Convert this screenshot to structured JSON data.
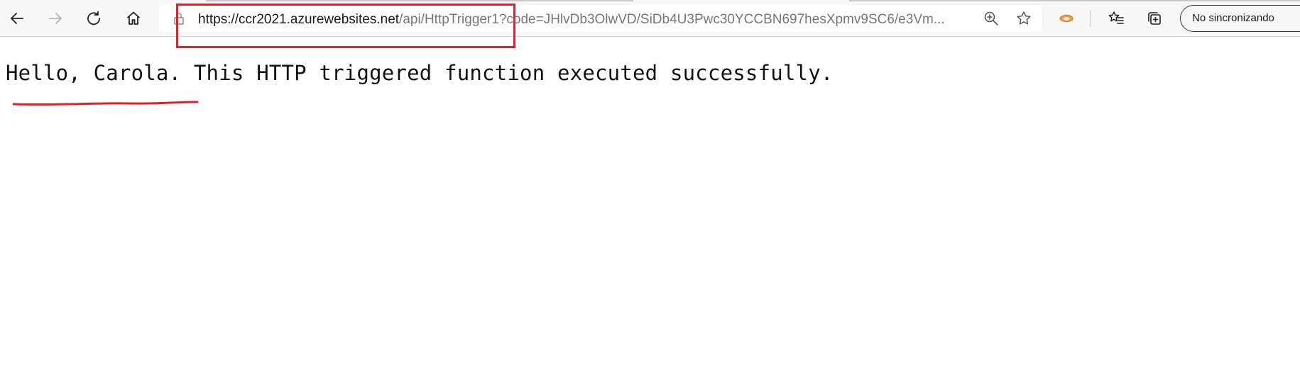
{
  "browser": {
    "url_host": "https://ccr2021.azurewebsites.net",
    "url_rest": "/api/HttpTrigger1?code=JHlvDb3OlwVD/SiDb4U3Pwc30YCCBN697hesXpmv9SC6/e3Vm...",
    "profile_label": "No sincronizando",
    "buttons": {
      "back_icon": "arrow-left-icon",
      "forward_icon": "arrow-right-icon",
      "refresh_icon": "refresh-icon",
      "home_icon": "home-icon",
      "zoom_icon": "zoom-in-icon",
      "favorite_icon": "star-icon",
      "extension_icon": "extension-icon",
      "favorites_icon": "favorites-icon",
      "collections_icon": "collections-icon"
    }
  },
  "page": {
    "message": "Hello, Carola. This HTTP triggered function executed successfully."
  },
  "annotations": {
    "color": "#e0202a"
  }
}
